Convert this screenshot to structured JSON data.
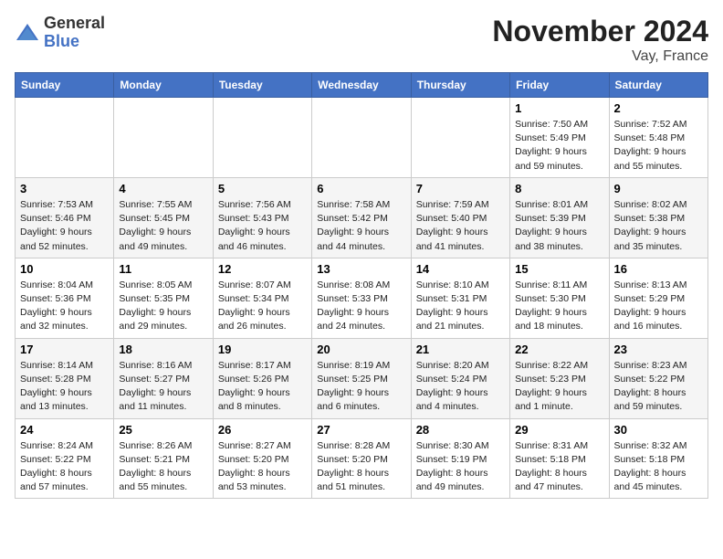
{
  "header": {
    "logo_general": "General",
    "logo_blue": "Blue",
    "month_title": "November 2024",
    "location": "Vay, France"
  },
  "days_of_week": [
    "Sunday",
    "Monday",
    "Tuesday",
    "Wednesday",
    "Thursday",
    "Friday",
    "Saturday"
  ],
  "weeks": [
    {
      "days": [
        {
          "num": "",
          "info": ""
        },
        {
          "num": "",
          "info": ""
        },
        {
          "num": "",
          "info": ""
        },
        {
          "num": "",
          "info": ""
        },
        {
          "num": "",
          "info": ""
        },
        {
          "num": "1",
          "info": "Sunrise: 7:50 AM\nSunset: 5:49 PM\nDaylight: 9 hours and 59 minutes."
        },
        {
          "num": "2",
          "info": "Sunrise: 7:52 AM\nSunset: 5:48 PM\nDaylight: 9 hours and 55 minutes."
        }
      ]
    },
    {
      "days": [
        {
          "num": "3",
          "info": "Sunrise: 7:53 AM\nSunset: 5:46 PM\nDaylight: 9 hours and 52 minutes."
        },
        {
          "num": "4",
          "info": "Sunrise: 7:55 AM\nSunset: 5:45 PM\nDaylight: 9 hours and 49 minutes."
        },
        {
          "num": "5",
          "info": "Sunrise: 7:56 AM\nSunset: 5:43 PM\nDaylight: 9 hours and 46 minutes."
        },
        {
          "num": "6",
          "info": "Sunrise: 7:58 AM\nSunset: 5:42 PM\nDaylight: 9 hours and 44 minutes."
        },
        {
          "num": "7",
          "info": "Sunrise: 7:59 AM\nSunset: 5:40 PM\nDaylight: 9 hours and 41 minutes."
        },
        {
          "num": "8",
          "info": "Sunrise: 8:01 AM\nSunset: 5:39 PM\nDaylight: 9 hours and 38 minutes."
        },
        {
          "num": "9",
          "info": "Sunrise: 8:02 AM\nSunset: 5:38 PM\nDaylight: 9 hours and 35 minutes."
        }
      ]
    },
    {
      "days": [
        {
          "num": "10",
          "info": "Sunrise: 8:04 AM\nSunset: 5:36 PM\nDaylight: 9 hours and 32 minutes."
        },
        {
          "num": "11",
          "info": "Sunrise: 8:05 AM\nSunset: 5:35 PM\nDaylight: 9 hours and 29 minutes."
        },
        {
          "num": "12",
          "info": "Sunrise: 8:07 AM\nSunset: 5:34 PM\nDaylight: 9 hours and 26 minutes."
        },
        {
          "num": "13",
          "info": "Sunrise: 8:08 AM\nSunset: 5:33 PM\nDaylight: 9 hours and 24 minutes."
        },
        {
          "num": "14",
          "info": "Sunrise: 8:10 AM\nSunset: 5:31 PM\nDaylight: 9 hours and 21 minutes."
        },
        {
          "num": "15",
          "info": "Sunrise: 8:11 AM\nSunset: 5:30 PM\nDaylight: 9 hours and 18 minutes."
        },
        {
          "num": "16",
          "info": "Sunrise: 8:13 AM\nSunset: 5:29 PM\nDaylight: 9 hours and 16 minutes."
        }
      ]
    },
    {
      "days": [
        {
          "num": "17",
          "info": "Sunrise: 8:14 AM\nSunset: 5:28 PM\nDaylight: 9 hours and 13 minutes."
        },
        {
          "num": "18",
          "info": "Sunrise: 8:16 AM\nSunset: 5:27 PM\nDaylight: 9 hours and 11 minutes."
        },
        {
          "num": "19",
          "info": "Sunrise: 8:17 AM\nSunset: 5:26 PM\nDaylight: 9 hours and 8 minutes."
        },
        {
          "num": "20",
          "info": "Sunrise: 8:19 AM\nSunset: 5:25 PM\nDaylight: 9 hours and 6 minutes."
        },
        {
          "num": "21",
          "info": "Sunrise: 8:20 AM\nSunset: 5:24 PM\nDaylight: 9 hours and 4 minutes."
        },
        {
          "num": "22",
          "info": "Sunrise: 8:22 AM\nSunset: 5:23 PM\nDaylight: 9 hours and 1 minute."
        },
        {
          "num": "23",
          "info": "Sunrise: 8:23 AM\nSunset: 5:22 PM\nDaylight: 8 hours and 59 minutes."
        }
      ]
    },
    {
      "days": [
        {
          "num": "24",
          "info": "Sunrise: 8:24 AM\nSunset: 5:22 PM\nDaylight: 8 hours and 57 minutes."
        },
        {
          "num": "25",
          "info": "Sunrise: 8:26 AM\nSunset: 5:21 PM\nDaylight: 8 hours and 55 minutes."
        },
        {
          "num": "26",
          "info": "Sunrise: 8:27 AM\nSunset: 5:20 PM\nDaylight: 8 hours and 53 minutes."
        },
        {
          "num": "27",
          "info": "Sunrise: 8:28 AM\nSunset: 5:20 PM\nDaylight: 8 hours and 51 minutes."
        },
        {
          "num": "28",
          "info": "Sunrise: 8:30 AM\nSunset: 5:19 PM\nDaylight: 8 hours and 49 minutes."
        },
        {
          "num": "29",
          "info": "Sunrise: 8:31 AM\nSunset: 5:18 PM\nDaylight: 8 hours and 47 minutes."
        },
        {
          "num": "30",
          "info": "Sunrise: 8:32 AM\nSunset: 5:18 PM\nDaylight: 8 hours and 45 minutes."
        }
      ]
    }
  ]
}
